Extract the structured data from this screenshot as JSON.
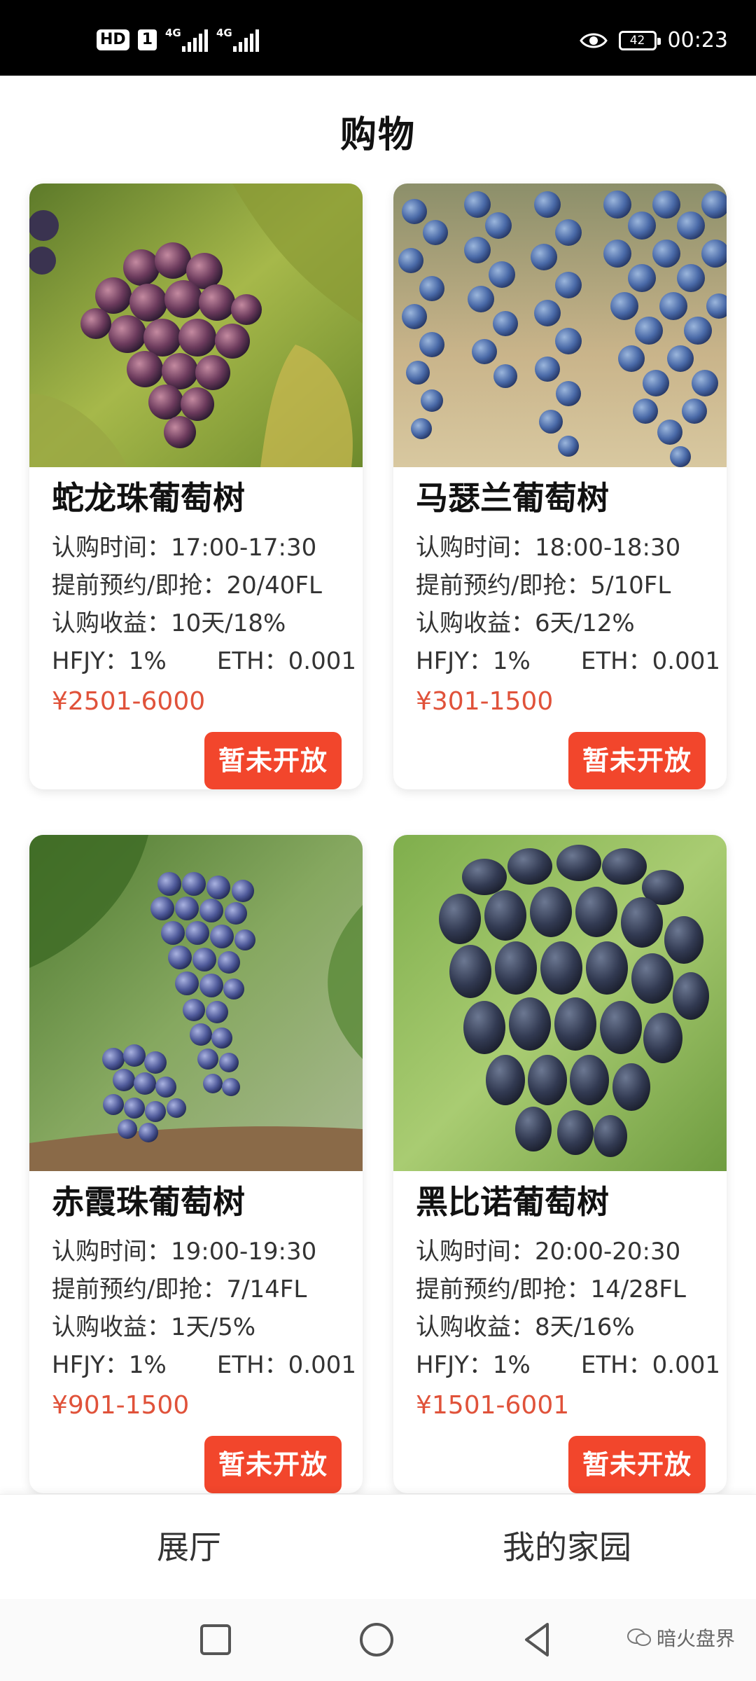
{
  "status_bar": {
    "hd_label": "HD",
    "sim_label": "1",
    "signal1_label": "4G",
    "signal2_label": "4G",
    "battery_level": "42",
    "time": "00:23",
    "icons": [
      "eye-icon",
      "battery-icon"
    ]
  },
  "header": {
    "title": "购物"
  },
  "products": [
    {
      "name": "蛇龙珠葡萄树",
      "subscribe_time": "认购时间：17:00-17:30",
      "reserve": "提前预约/即抢：20/40FL",
      "yield": "认购收益：10天/18%",
      "hfjy": "HFJY：1%",
      "eth": "ETH：0.001",
      "price": "¥2501-6000",
      "button": "暂未开放"
    },
    {
      "name": "马瑟兰葡萄树",
      "subscribe_time": "认购时间：18:00-18:30",
      "reserve": "提前预约/即抢：5/10FL",
      "yield": "认购收益：6天/12%",
      "hfjy": "HFJY：1%",
      "eth": "ETH：0.001",
      "price": "¥301-1500",
      "button": "暂未开放"
    },
    {
      "name": "赤霞珠葡萄树",
      "subscribe_time": "认购时间：19:00-19:30",
      "reserve": "提前预约/即抢：7/14FL",
      "yield": "认购收益：1天/5%",
      "hfjy": "HFJY：1%",
      "eth": "ETH：0.001",
      "price": "¥901-1500",
      "button": "暂未开放"
    },
    {
      "name": "黑比诺葡萄树",
      "subscribe_time": "认购时间：20:00-20:30",
      "reserve": "提前预约/即抢：14/28FL",
      "yield": "认购收益：8天/16%",
      "hfjy": "HFJY：1%",
      "eth": "ETH：0.001",
      "price": "¥1501-6001",
      "button": "暂未开放"
    }
  ],
  "tabs": [
    {
      "label": "展厅"
    },
    {
      "label": "我的家园"
    }
  ],
  "watermark": {
    "text": "暗火盘界"
  },
  "colors": {
    "accent": "#f2462c",
    "price": "#e0523a",
    "status_bar": "#000000"
  }
}
